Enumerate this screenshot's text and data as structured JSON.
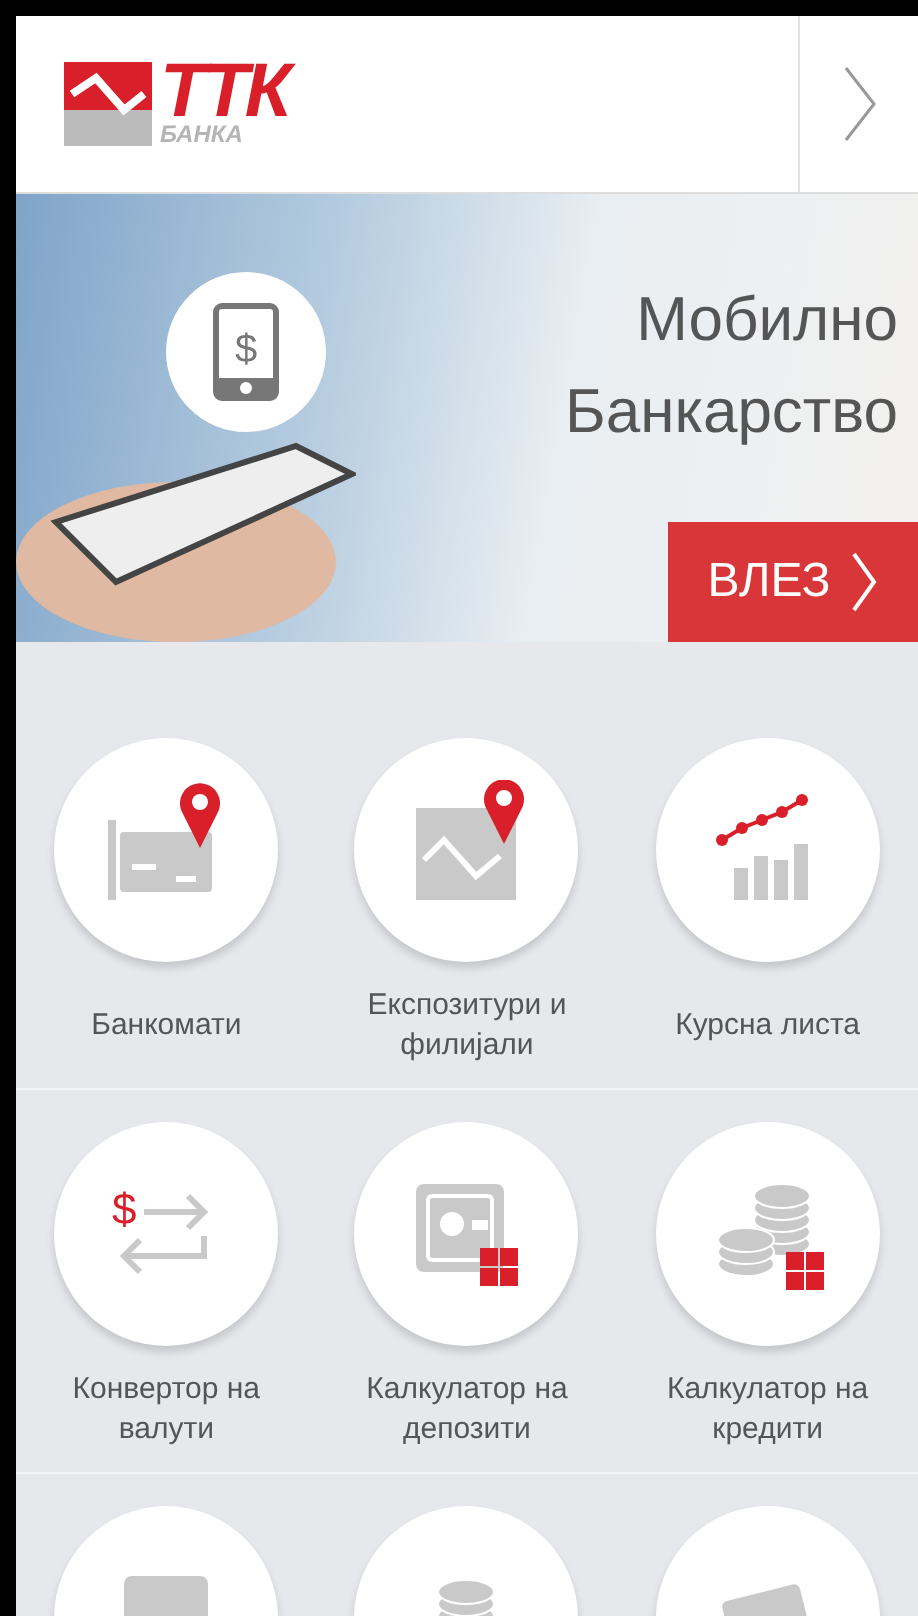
{
  "header": {
    "logo": {
      "main": "ТТК",
      "sub": "БАНКА"
    }
  },
  "banner": {
    "icon_glyph": "$",
    "title": [
      "Мобилно",
      "Банкарство"
    ],
    "login_button": "ВЛЕЗ"
  },
  "tiles": [
    {
      "kind": "atm",
      "label": "Банкомати"
    },
    {
      "kind": "branch",
      "label": "Експозитури и филијали"
    },
    {
      "kind": "rates",
      "label": "Курсна листа"
    },
    {
      "kind": "converter",
      "glyph": "$",
      "label": "Конвертор на валути"
    },
    {
      "kind": "deposit",
      "label": "Калкулатор на депозити"
    },
    {
      "kind": "loan",
      "label": "Калкулатор на кредити"
    },
    {
      "kind": "safe"
    },
    {
      "kind": "coins"
    },
    {
      "kind": "cards"
    }
  ]
}
